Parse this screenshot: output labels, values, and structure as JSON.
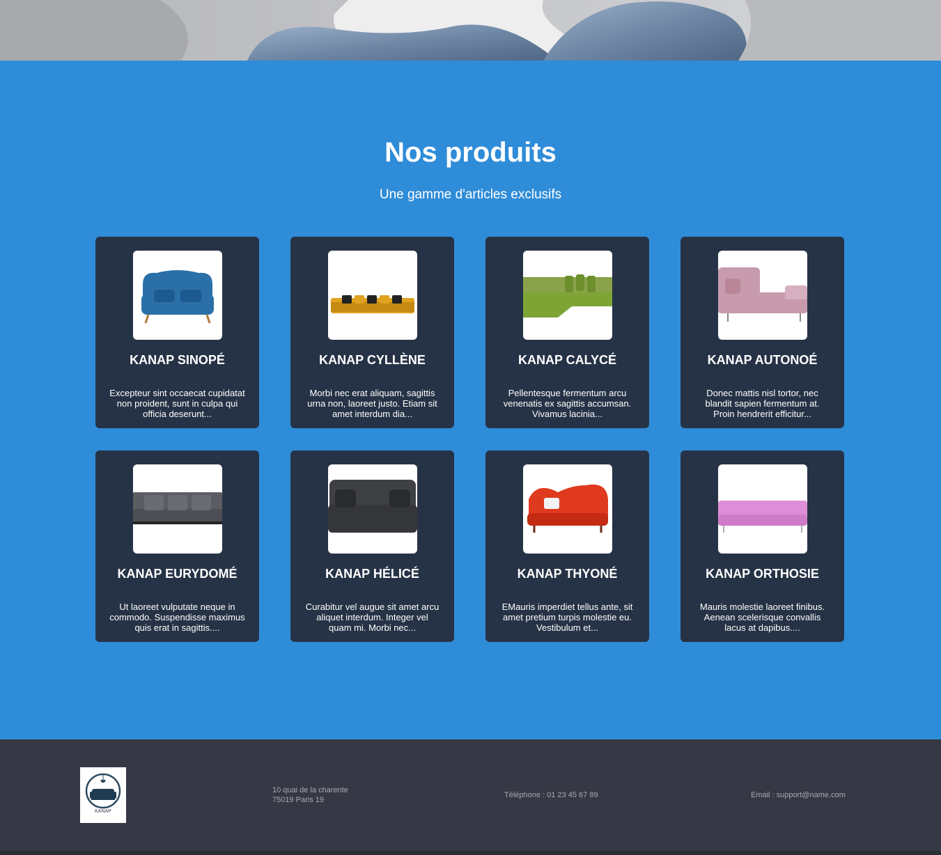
{
  "products": {
    "title": "Nos produits",
    "subtitle": "Une gamme d'articles exclusifs",
    "items": [
      {
        "name": "KANAP SINOPÉ",
        "description": "Excepteur sint occaecat cupidatat non proident, sunt in culpa qui officia deserunt...",
        "color": "#2b6fa8",
        "icon": "blue-armchair-sofa"
      },
      {
        "name": "KANAP CYLLÈNE",
        "description": "Morbi nec erat aliquam, sagittis urna non, laoreet justo. Etiam sit amet interdum dia...",
        "color": "#e0a21f",
        "icon": "yellow-sofa"
      },
      {
        "name": "KANAP CALYCÉ",
        "description": "Pellentesque fermentum arcu venenatis ex sagittis accumsan. Vivamus lacinia...",
        "color": "#7fa436",
        "icon": "green-corner-sofa"
      },
      {
        "name": "KANAP AUTONOÉ",
        "description": "Donec mattis nisl tortor, nec blandit sapien fermentum at. Proin hendrerit efficitur...",
        "color": "#c79aad",
        "icon": "pink-chaise-sofa"
      },
      {
        "name": "KANAP EURYDOMÉ",
        "description": "Ut laoreet vulputate neque in commodo. Suspendisse maximus quis erat in sagittis....",
        "color": "#4d4f55",
        "icon": "grey-sofa"
      },
      {
        "name": "KANAP HÉLICÉ",
        "description": "Curabitur vel augue sit amet arcu aliquet interdum. Integer vel quam mi. Morbi nec...",
        "color": "#3f4044",
        "icon": "dark-grey-loveseat"
      },
      {
        "name": "KANAP THYONÉ",
        "description": "EMauris imperdiet tellus ante, sit amet pretium turpis molestie eu. Vestibulum et...",
        "color": "#e03a1e",
        "icon": "red-sofa"
      },
      {
        "name": "KANAP ORTHOSIE",
        "description": "Mauris molestie laoreet finibus. Aenean scelerisque convallis lacus at dapibus....",
        "color": "#dc8fd6",
        "icon": "pink-chesterfield-sofa"
      }
    ]
  },
  "footer": {
    "logo_text": "KANAP",
    "address_line1": "10 quai de la charente",
    "address_line2": "75019 Paris 19",
    "phone": "Téléphone : 01 23 45 67 89",
    "email": "Email : support@name.com"
  },
  "colors": {
    "section_bg": "#2f8cd8",
    "card_bg": "#263346",
    "footer_bg": "#363945"
  }
}
